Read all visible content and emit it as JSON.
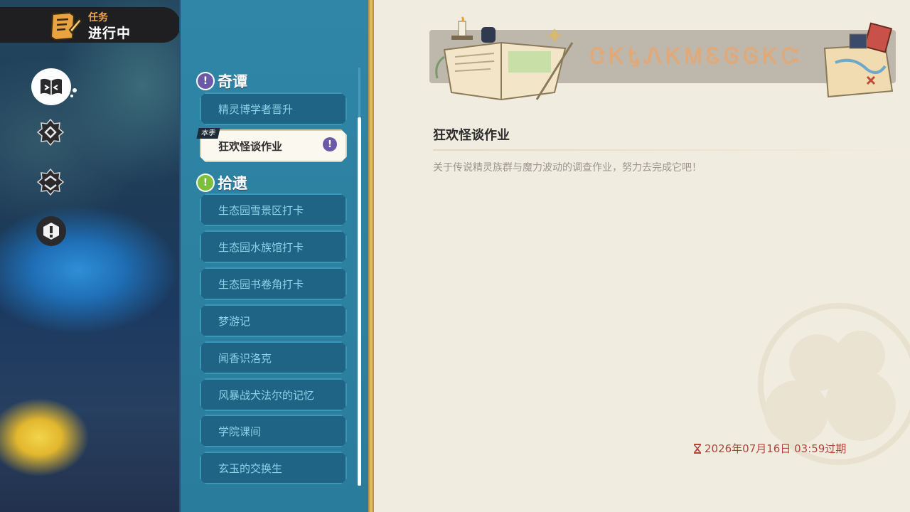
{
  "task_badge": {
    "label_small": "任务",
    "label_big": "进行中"
  },
  "side_buttons": [
    {
      "name": "book-icon"
    },
    {
      "name": "gear-icon"
    },
    {
      "name": "gear-icon"
    },
    {
      "name": "alert-icon"
    }
  ],
  "categories": [
    {
      "title": "奇谭",
      "icon_color": "#6a5aa8",
      "quests": [
        "精灵博学者晋升",
        "狂欢怪谈作业"
      ]
    },
    {
      "title": "拾遗",
      "icon_color": "#7cbf3b",
      "quests": [
        "生态园雪景区打卡",
        "生态园水族馆打卡",
        "生态园书卷角打卡",
        "梦游记",
        "闻香识洛克",
        "风暴战犬法尔的记忆",
        "学院课间",
        "玄玉的交换生"
      ]
    }
  ],
  "selected_tag": "本季",
  "banner_runes": "ᏣᏦᎿᏁᏦᎷᏋᎶᎶᏦᏨ",
  "detail": {
    "title": "狂欢怪谈作业",
    "description": "关于传说精灵族群与魔力波动的调查作业，努力去完成它吧！",
    "expiry": "2026年07月16日 03:59过期"
  },
  "colors": {
    "accent_gold": "#e6c56e",
    "expiry_red": "#b3443a"
  }
}
